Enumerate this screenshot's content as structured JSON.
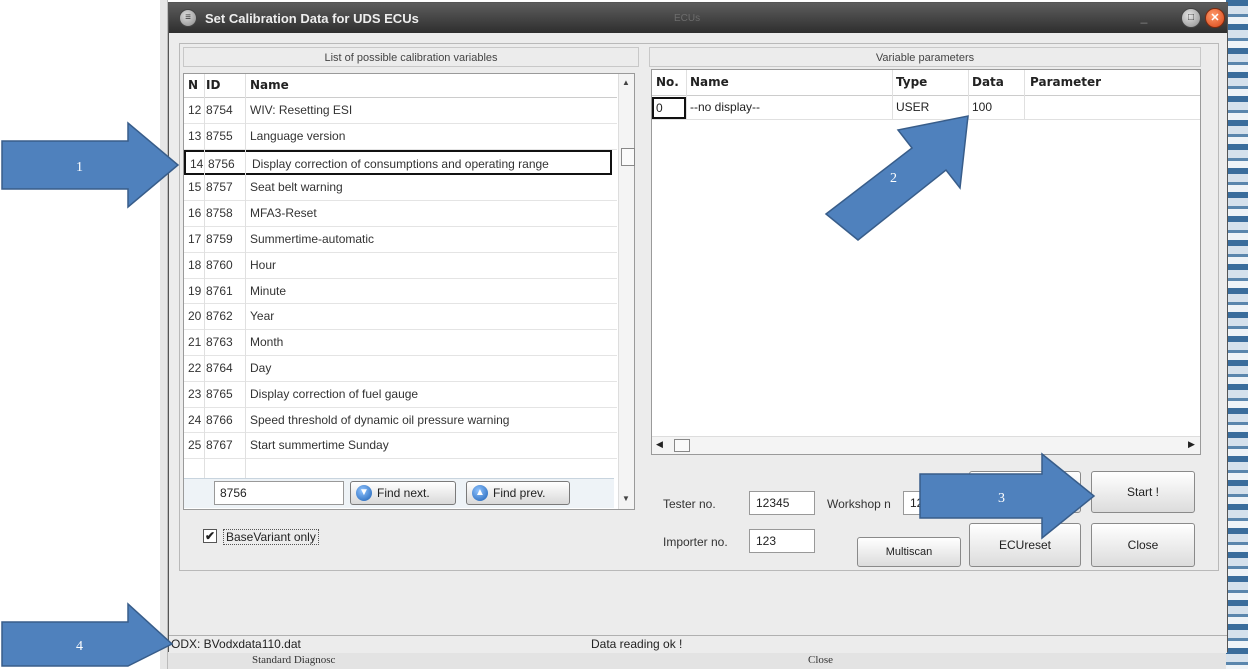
{
  "window": {
    "title": "Set Calibration Data for UDS ECUs",
    "ghost_title": "ECUs"
  },
  "left_panel": {
    "title": "List of possible calibration variables",
    "columns": [
      "N",
      "ID",
      "Name"
    ],
    "rows": [
      {
        "n": "12",
        "id": "8754",
        "name": "WIV: Resetting ESI",
        "selected": false
      },
      {
        "n": "13",
        "id": "8755",
        "name": "Language version",
        "selected": false
      },
      {
        "n": "14",
        "id": "8756",
        "name": "Display correction of consumptions and operating range",
        "selected": true
      },
      {
        "n": "15",
        "id": "8757",
        "name": "Seat belt warning",
        "selected": false
      },
      {
        "n": "16",
        "id": "8758",
        "name": "MFA3-Reset",
        "selected": false
      },
      {
        "n": "17",
        "id": "8759",
        "name": "Summertime-automatic",
        "selected": false
      },
      {
        "n": "18",
        "id": "8760",
        "name": "Hour",
        "selected": false
      },
      {
        "n": "19",
        "id": "8761",
        "name": "Minute",
        "selected": false
      },
      {
        "n": "20",
        "id": "8762",
        "name": "Year",
        "selected": false
      },
      {
        "n": "21",
        "id": "8763",
        "name": "Month",
        "selected": false
      },
      {
        "n": "22",
        "id": "8764",
        "name": "Day",
        "selected": false
      },
      {
        "n": "23",
        "id": "8765",
        "name": "Display correction of fuel gauge",
        "selected": false
      },
      {
        "n": "24",
        "id": "8766",
        "name": "Speed threshold of dynamic oil pressure warning",
        "selected": false
      },
      {
        "n": "25",
        "id": "8767",
        "name": "Start summertime Sunday",
        "selected": false
      }
    ],
    "search_value": "8756",
    "find_next_label": "Find next.",
    "find_prev_label": "Find prev.",
    "basevariant_label": "BaseVariant only",
    "basevariant_checked": true
  },
  "right_panel": {
    "title": "Variable parameters",
    "columns": {
      "no": "No.",
      "name": "Name",
      "type": "Type",
      "data": "Data",
      "parameter": "Parameter"
    },
    "row": {
      "no": "0",
      "name": "--no display--",
      "type": "USER",
      "data": "100",
      "parameter": ""
    },
    "tester_label": "Tester no.",
    "tester_value": "12345",
    "workshop_label": "Workshop n",
    "workshop_value": "12",
    "importer_label": "Importer no.",
    "importer_value": "123",
    "multiscan_label": "Multiscan",
    "ecureset_label": "ECUreset",
    "start_label": "Start !",
    "close_label": "Close"
  },
  "status": {
    "file": "ODX: BVodxdata110.dat",
    "message": "Data reading ok !"
  },
  "background": {
    "bottom_left_text": "Standard Diagnosc",
    "bottom_right_text": "Close"
  },
  "annotations": [
    "1",
    "2",
    "3",
    "4"
  ],
  "colors": {
    "arrow_fill": "#4f81bd",
    "arrow_stroke": "#385d8a",
    "titlebar": "#3a3a3a",
    "close_button": "#e0521f"
  }
}
